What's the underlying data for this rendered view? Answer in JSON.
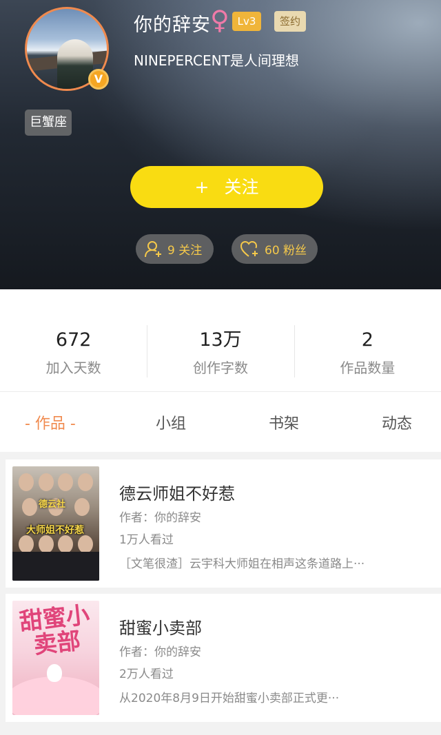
{
  "profile": {
    "name": "你的辞安",
    "gender_icon": "♀",
    "level": "Lv3",
    "signed": "签约",
    "bio": "NINEPERCENT是人间理想",
    "zodiac": "巨蟹座",
    "verified_badge": "V",
    "follow_plus": "+",
    "follow_label": "关注",
    "following": "9 关注",
    "fans": "60 粉丝"
  },
  "stats": [
    {
      "value": "672",
      "label": "加入天数"
    },
    {
      "value": "13万",
      "label": "创作字数"
    },
    {
      "value": "2",
      "label": "作品数量"
    }
  ],
  "tabs": [
    {
      "label": "- 作品 -"
    },
    {
      "label": "小组"
    },
    {
      "label": "书架"
    },
    {
      "label": "动态"
    }
  ],
  "works": [
    {
      "title": "德云师姐不好惹",
      "author": "作者：你的辞安",
      "views": "1万人看过",
      "desc": "［文笔很渣］云宇科大师姐在相声这条道路上···",
      "cover_title": "大师姐不好惹",
      "cover_sub": "德云社"
    },
    {
      "title": "甜蜜小卖部",
      "author": "作者：你的辞安",
      "views": "2万人看过",
      "desc": "从2020年8月9日开始甜蜜小卖部正式更···",
      "cover_title": "甜蜜小卖部"
    }
  ],
  "colors": {
    "accent": "#f08a4e",
    "follow_button": "#f9dc12",
    "stat_pill_text": "#f6c94a",
    "level_badge": "#f0b53a"
  },
  "icons": {
    "gender": "female-icon",
    "verified": "verified-v-icon",
    "following": "user-plus-icon",
    "fans": "heart-plus-icon"
  }
}
